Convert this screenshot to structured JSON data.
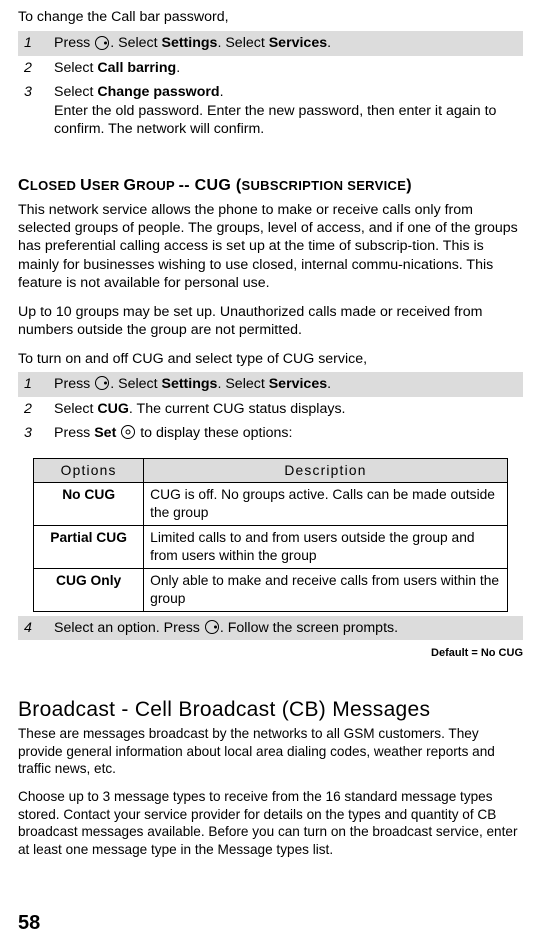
{
  "intro1": "To change the Call bar password,",
  "steps1": [
    {
      "n": "1",
      "txt": "Press [icon-circle]. Select  <b>Settings</b>. Select  <b>Services</b>.",
      "shade": true
    },
    {
      "n": "2",
      "txt": "Select  <b>Call barring</b>.",
      "shade": false
    },
    {
      "n": "3",
      "txt": "Select  <b>Change password</b>.<br>Enter the old password. Enter the new password, then enter it again to confirm. The network will confirm.",
      "shade": false
    }
  ],
  "heading_cug_big1": "C",
  "heading_cug_small1": "LOSED ",
  "heading_cug_big2": "U",
  "heading_cug_small2": "SER ",
  "heading_cug_big3": "G",
  "heading_cug_small3": "ROUP ",
  "heading_cug_mid": "-- CUG (",
  "heading_cug_small4": "SUBSCRIPTION SERVICE",
  "heading_cug_end": ")",
  "cug_p1": "This network service allows the phone to make or receive calls only from selected groups of people. The groups, level of access, and if one of the groups has preferential calling access is set up at the time of subscrip-tion. This is mainly for businesses wishing to use closed, internal commu-nications. This feature is not available for personal use.",
  "cug_p2": "Up to 10 groups may be set up. Unauthorized calls made or received from numbers outside the group are not permitted.",
  "cug_p3": "To turn on and off CUG and select type of CUG service,",
  "steps2": [
    {
      "n": "1",
      "txt": "Press [icon-circle]. Select  <b>Settings</b>. Select  <b>Services</b>.",
      "shade": true
    },
    {
      "n": "2",
      "txt": "Select  <b>CUG</b>. The current CUG status displays.",
      "shade": false
    },
    {
      "n": "3",
      "txt": "Press  <b>Set</b> [icon-select] to display these options:",
      "shade": false
    }
  ],
  "table_h1": "Options",
  "table_h2": "Description",
  "table_rows": [
    {
      "opt": "No CUG",
      "desc": "CUG is off. No groups active. Calls can be made outside the group"
    },
    {
      "opt": "Partial CUG",
      "desc": "Limited calls to and from users outside the group and from users within the group"
    },
    {
      "opt": "CUG Only",
      "desc": "Only able to make and receive calls from users within the group"
    }
  ],
  "step4": {
    "n": "4",
    "txt": "Select an option. Press [icon-circle]. Follow the screen prompts.",
    "shade": true
  },
  "default_line": "Default = No CUG",
  "h_broadcast": "Broadcast - Cell Broadcast (CB) Messages",
  "bc_p1": "These are messages broadcast by the networks to all GSM customers. They provide general information about local area dialing codes, weather reports and traffic news, etc.",
  "bc_p2": "Choose up to 3 message types to receive from the 16 standard message types stored. Contact your service provider for details on the types and quantity of CB broadcast messages available. Before you can turn on the broadcast service, enter at least one message type in the Message types list.",
  "page_num": "58"
}
